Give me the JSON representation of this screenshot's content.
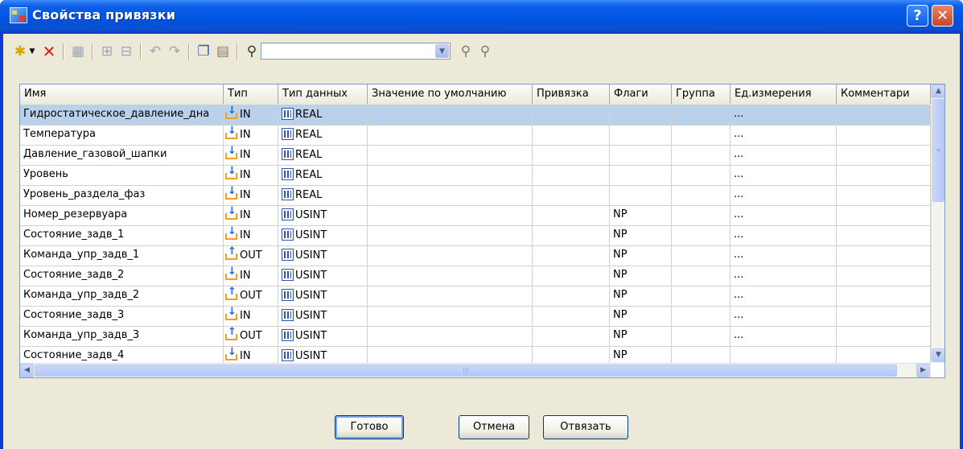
{
  "window": {
    "title": "Свойства привязки"
  },
  "title_buttons": {
    "help": "?",
    "close": "✕"
  },
  "toolbar": {
    "icons": [
      "new-item-icon",
      "dropdown-arrow-icon",
      "delete-icon",
      "properties-icon",
      "group-icon",
      "ungroup-icon",
      "undo-icon",
      "redo-icon",
      "copy-icon",
      "paste-icon",
      "find-icon",
      "find-next-icon",
      "find-prev-icon"
    ],
    "search_value": ""
  },
  "grid": {
    "columns": [
      "Имя",
      "Тип",
      "Тип данных",
      "Значение по умолчанию",
      "Привязка",
      "Флаги",
      "Группа",
      "Ед.измерения",
      "Комментари"
    ],
    "rows": [
      {
        "name": "Гидростатическое_давление_дна",
        "dir": "IN",
        "dtype": "REAL",
        "default": "",
        "bind": "",
        "flags": "",
        "group": "",
        "unit": "...",
        "comment": "",
        "selected": true
      },
      {
        "name": "Температура",
        "dir": "IN",
        "dtype": "REAL",
        "default": "",
        "bind": "",
        "flags": "",
        "group": "",
        "unit": "...",
        "comment": ""
      },
      {
        "name": "Давление_газовой_шапки",
        "dir": "IN",
        "dtype": "REAL",
        "default": "",
        "bind": "",
        "flags": "",
        "group": "",
        "unit": "...",
        "comment": ""
      },
      {
        "name": "Уровень",
        "dir": "IN",
        "dtype": "REAL",
        "default": "",
        "bind": "",
        "flags": "",
        "group": "",
        "unit": "...",
        "comment": ""
      },
      {
        "name": "Уровень_раздела_фаз",
        "dir": "IN",
        "dtype": "REAL",
        "default": "",
        "bind": "",
        "flags": "",
        "group": "",
        "unit": "...",
        "comment": ""
      },
      {
        "name": "Номер_резервуара",
        "dir": "IN",
        "dtype": "USINT",
        "default": "",
        "bind": "",
        "flags": "NP",
        "group": "",
        "unit": "...",
        "comment": ""
      },
      {
        "name": "Состояние_задв_1",
        "dir": "IN",
        "dtype": "USINT",
        "default": "",
        "bind": "",
        "flags": "NP",
        "group": "",
        "unit": "...",
        "comment": ""
      },
      {
        "name": "Команда_упр_задв_1",
        "dir": "OUT",
        "dtype": "USINT",
        "default": "",
        "bind": "",
        "flags": "NP",
        "group": "",
        "unit": "...",
        "comment": ""
      },
      {
        "name": "Состояние_задв_2",
        "dir": "IN",
        "dtype": "USINT",
        "default": "",
        "bind": "",
        "flags": "NP",
        "group": "",
        "unit": "...",
        "comment": ""
      },
      {
        "name": "Команда_упр_задв_2",
        "dir": "OUT",
        "dtype": "USINT",
        "default": "",
        "bind": "",
        "flags": "NP",
        "group": "",
        "unit": "...",
        "comment": ""
      },
      {
        "name": "Состояние_задв_3",
        "dir": "IN",
        "dtype": "USINT",
        "default": "",
        "bind": "",
        "flags": "NP",
        "group": "",
        "unit": "...",
        "comment": ""
      },
      {
        "name": "Команда_упр_задв_3",
        "dir": "OUT",
        "dtype": "USINT",
        "default": "",
        "bind": "",
        "flags": "NP",
        "group": "",
        "unit": "...",
        "comment": ""
      },
      {
        "name": "Состояние_задв_4",
        "dir": "IN",
        "dtype": "USINT",
        "default": "",
        "bind": "",
        "flags": "NP",
        "group": "",
        "unit": "",
        "comment": ""
      }
    ]
  },
  "buttons": {
    "ok": "Готово",
    "cancel": "Отмена",
    "unbind": "Отвязать"
  },
  "colors": {
    "titlebar": "#0054e3",
    "selection": "#b9d1ea",
    "face": "#ece9d8"
  }
}
